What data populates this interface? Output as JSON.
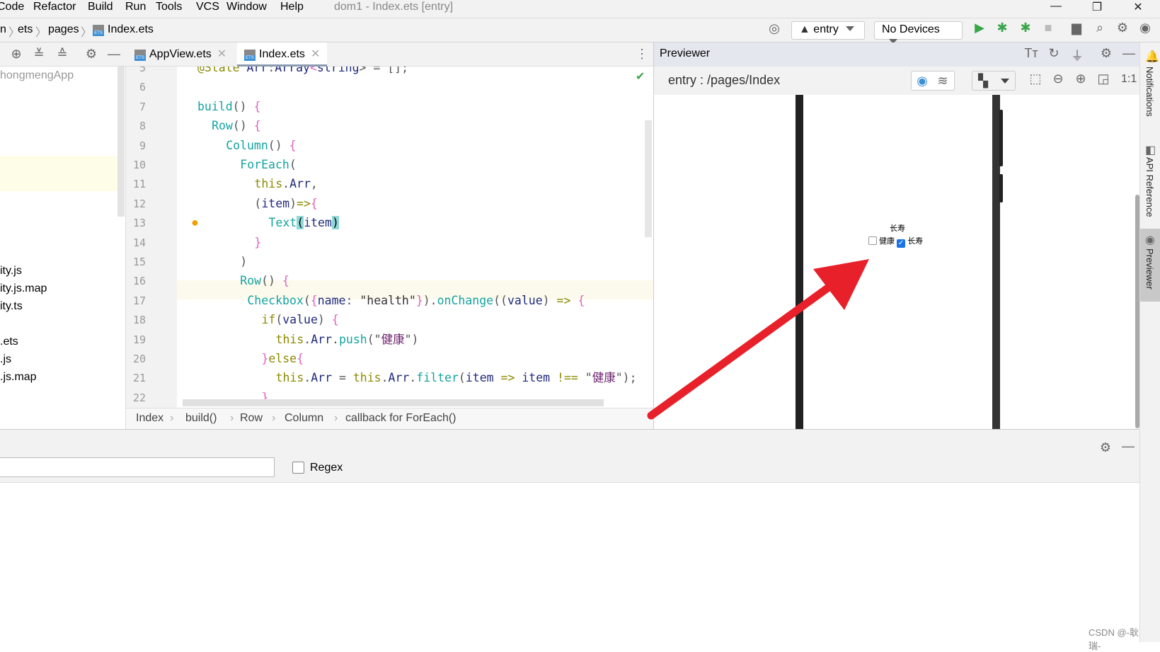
{
  "menu": {
    "items": [
      "Code",
      "Refactor",
      "Build",
      "Run",
      "Tools",
      "VCS",
      "Window",
      "Help"
    ],
    "title": "dom1 - Index.ets [entry]"
  },
  "nav": {
    "crumbs": [
      "n",
      "ets",
      "pages",
      "Index.ets"
    ],
    "module": "entry",
    "device": "No Devices"
  },
  "tabs": [
    {
      "label": "AppView.ets"
    },
    {
      "label": "Index.ets",
      "active": true
    }
  ],
  "tree": {
    "root": "hongmengApp",
    "items": [
      "ity.js",
      "ity.js.map",
      "ity.ts",
      ".ets",
      ".js",
      ".js.map"
    ]
  },
  "editor": {
    "lines": [
      {
        "n": "5",
        "indent": 0,
        "tokens": [
          [
            "@State ",
            "kw"
          ],
          [
            "Arr",
            "id"
          ],
          [
            ":",
            "pu"
          ],
          [
            "Array",
            "id"
          ],
          [
            "<",
            "br"
          ],
          [
            "string",
            "id"
          ],
          [
            "> = [];",
            "pu"
          ]
        ]
      },
      {
        "n": "6",
        "indent": 0,
        "tokens": []
      },
      {
        "n": "7",
        "indent": 0,
        "tokens": [
          [
            "build",
            "fn"
          ],
          [
            "() ",
            "pu"
          ],
          [
            "{",
            "br"
          ]
        ]
      },
      {
        "n": "8",
        "indent": 2,
        "tokens": [
          [
            "Row",
            "fn"
          ],
          [
            "() ",
            "pu"
          ],
          [
            "{",
            "br"
          ]
        ]
      },
      {
        "n": "9",
        "indent": 4,
        "tokens": [
          [
            "Column",
            "fn"
          ],
          [
            "() ",
            "pu"
          ],
          [
            "{",
            "br"
          ]
        ]
      },
      {
        "n": "10",
        "indent": 6,
        "tokens": [
          [
            "ForEach",
            "fn"
          ],
          [
            "(",
            "pu"
          ]
        ]
      },
      {
        "n": "11",
        "indent": 8,
        "tokens": [
          [
            "this",
            "kw"
          ],
          [
            ".",
            "pu"
          ],
          [
            "Arr",
            "id"
          ],
          [
            ",",
            "pu"
          ]
        ]
      },
      {
        "n": "12",
        "indent": 8,
        "tokens": [
          [
            "(",
            "pu"
          ],
          [
            "item",
            "id"
          ],
          [
            ")",
            "pu"
          ],
          [
            "=>",
            "kw"
          ],
          [
            "{",
            "br"
          ]
        ]
      },
      {
        "n": "13",
        "indent": 10,
        "tokens": [
          [
            "Text",
            "fn"
          ],
          [
            "(",
            "hl"
          ],
          [
            "item",
            "id"
          ],
          [
            ")",
            "hl"
          ]
        ]
      },
      {
        "n": "14",
        "indent": 8,
        "tokens": [
          [
            "}",
            "br"
          ]
        ]
      },
      {
        "n": "15",
        "indent": 6,
        "tokens": [
          [
            ")",
            "pu"
          ]
        ]
      },
      {
        "n": "16",
        "indent": 6,
        "tokens": [
          [
            "Row",
            "fn"
          ],
          [
            "() ",
            "pu"
          ],
          [
            "{",
            "br"
          ]
        ]
      },
      {
        "n": "17",
        "indent": 7,
        "tokens": [
          [
            "Checkbox",
            "fn"
          ],
          [
            "(",
            "pu"
          ],
          [
            "{",
            "br"
          ],
          [
            "name",
            "id"
          ],
          [
            ": ",
            "pu"
          ],
          [
            "\"health\"",
            "st"
          ],
          [
            "}",
            "br"
          ],
          [
            ").",
            "pu"
          ],
          [
            "onChange",
            "fn"
          ],
          [
            "((",
            "pu"
          ],
          [
            "value",
            "id"
          ],
          [
            ") ",
            "pu"
          ],
          [
            "=> ",
            "kw"
          ],
          [
            "{",
            "br"
          ]
        ]
      },
      {
        "n": "18",
        "indent": 9,
        "tokens": [
          [
            "if",
            "kw"
          ],
          [
            "(",
            "pu"
          ],
          [
            "value",
            "id"
          ],
          [
            ") ",
            "pu"
          ],
          [
            "{",
            "br"
          ]
        ]
      },
      {
        "n": "19",
        "indent": 11,
        "tokens": [
          [
            "this",
            "kw"
          ],
          [
            ".",
            "pu"
          ],
          [
            "Arr",
            "id"
          ],
          [
            ".",
            "pu"
          ],
          [
            "push",
            "fn"
          ],
          [
            "(\"",
            "pu"
          ],
          [
            "健康",
            "cn"
          ],
          [
            "\")",
            "pu"
          ]
        ]
      },
      {
        "n": "20",
        "indent": 9,
        "tokens": [
          [
            "}",
            "br"
          ],
          [
            "else",
            "kw"
          ],
          [
            "{",
            "br"
          ]
        ]
      },
      {
        "n": "21",
        "indent": 11,
        "tokens": [
          [
            "this",
            "kw"
          ],
          [
            ".",
            "pu"
          ],
          [
            "Arr",
            "id"
          ],
          [
            " = ",
            "pu"
          ],
          [
            "this",
            "kw"
          ],
          [
            ".",
            "pu"
          ],
          [
            "Arr",
            "id"
          ],
          [
            ".",
            "pu"
          ],
          [
            "filter",
            "fn"
          ],
          [
            "(",
            "pu"
          ],
          [
            "item",
            "id"
          ],
          [
            " => ",
            "kw"
          ],
          [
            "item",
            "id"
          ],
          [
            " !== ",
            "kw"
          ],
          [
            "\"",
            "pu"
          ],
          [
            "健康",
            "cn"
          ],
          [
            "\");",
            "pu"
          ]
        ]
      },
      {
        "n": "22",
        "indent": 9,
        "tokens": [
          [
            "}",
            "br"
          ]
        ]
      }
    ],
    "breadcrumb": [
      "Index",
      "build()",
      "Row",
      "Column",
      "callback for ForEach()"
    ]
  },
  "previewer": {
    "title": "Previewer",
    "route": "entry : /pages/Index",
    "zoom_label": "1:1",
    "app": {
      "text": "长寿",
      "checkboxes": [
        {
          "label": "健康",
          "checked": false
        },
        {
          "label": "长寿",
          "checked": true
        }
      ]
    }
  },
  "side": {
    "notifications": "Notifications",
    "api": "API Reference",
    "previewer": "Previewer"
  },
  "find": {
    "regex_label": "Regex",
    "regex_checked": false,
    "value": ""
  },
  "watermark": "CSDN @-耿瑞-",
  "colors": {
    "accent": "#3d8fd6",
    "arrow": "#e8202a",
    "run": "#3aa64a"
  }
}
